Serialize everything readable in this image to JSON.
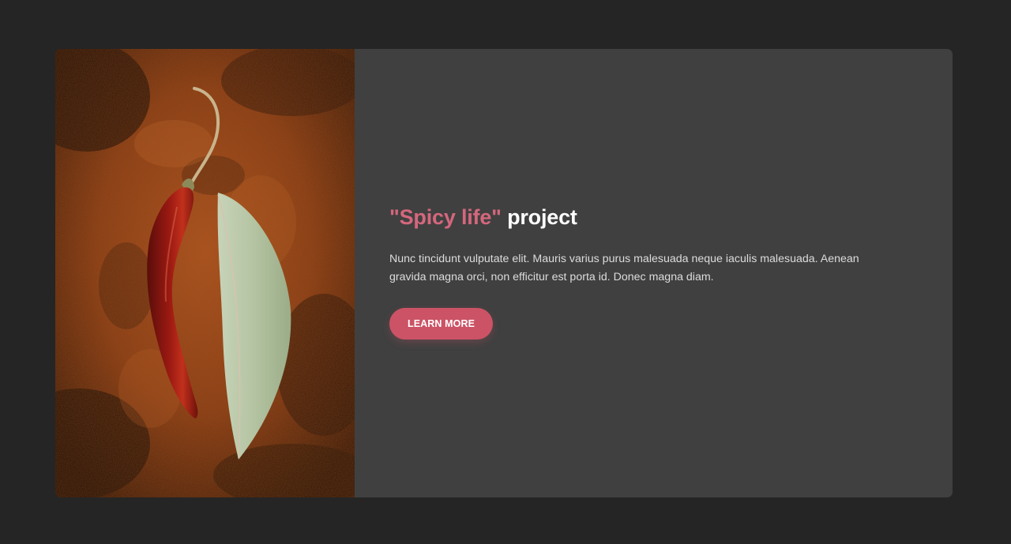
{
  "card": {
    "title_accent": "\"Spicy life\"",
    "title_rest": "project",
    "description": "Nunc tincidunt vulputate elit. Mauris varius purus malesuada neque iaculis malesuada. Aenean gravida magna orci, non efficitur est porta id. Donec magna diam.",
    "button_label": "LEARN MORE"
  },
  "colors": {
    "background": "#252525",
    "card": "#404040",
    "accent": "#d4677d",
    "button": "#cc5366",
    "text": "#dcdcdc"
  },
  "image": {
    "subject": "chili-pepper-and-bay-leaf-on-spice-powder"
  }
}
